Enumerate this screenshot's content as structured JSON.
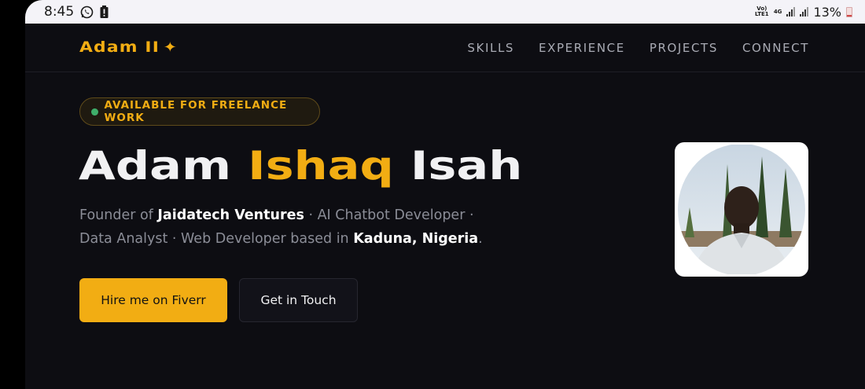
{
  "status_bar": {
    "time": "8:45",
    "network_volte": "Vo) LTE1",
    "network_type": "4G",
    "battery_percent": "13%"
  },
  "site": {
    "logo": "Adam II",
    "logo_icon": "sparkle-icon",
    "nav": [
      {
        "label": "SKILLS"
      },
      {
        "label": "EXPERIENCE"
      },
      {
        "label": "PROJECTS"
      },
      {
        "label": "CONNECT"
      }
    ],
    "badge": "AVAILABLE FOR FREELANCE WORK",
    "hero": {
      "first": "Adam",
      "middle": "Ishaq",
      "last": "Isah"
    },
    "tagline": {
      "prefix": "Founder of ",
      "company": "Jaidatech Ventures",
      "middle": " · AI Chatbot Developer · Data Analyst · Web Developer based in ",
      "location": "Kaduna, Nigeria",
      "suffix": "."
    },
    "buttons": {
      "primary": "Hire me on Fiverr",
      "secondary": "Get in Touch"
    }
  },
  "colors": {
    "accent": "#f2ad13",
    "background": "#0d0d12",
    "status_dot": "#3fae6a"
  }
}
